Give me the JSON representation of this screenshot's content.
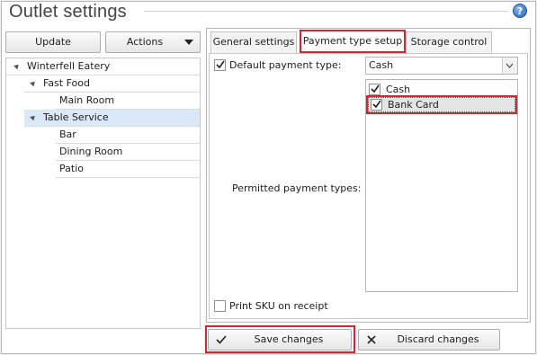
{
  "window": {
    "title": "Outlet settings",
    "help_icon": "help-icon"
  },
  "left": {
    "update_label": "Update",
    "actions_label": "Actions",
    "tree": [
      {
        "label": "Winterfell Eatery"
      },
      {
        "label": "Fast Food"
      },
      {
        "label": "Main Room"
      },
      {
        "label": "Table Service"
      },
      {
        "label": "Bar"
      },
      {
        "label": "Dining Room"
      },
      {
        "label": "Patio"
      }
    ]
  },
  "tabs": [
    {
      "label": "General settings"
    },
    {
      "label": "Payment type setup"
    },
    {
      "label": "Storage control"
    }
  ],
  "payment": {
    "default_label": "Default payment type:",
    "default_value": "Cash",
    "permitted_label": "Permitted payment types:",
    "types": [
      {
        "label": "Cash",
        "checked": true
      },
      {
        "label": "Bank Card",
        "checked": true
      }
    ],
    "sku_label": "Print SKU on receipt"
  },
  "footer": {
    "save_label": "Save changes",
    "discard_label": "Discard changes"
  },
  "colors": {
    "highlight": "#d3272f",
    "selected_row": "#dbe8f7"
  }
}
